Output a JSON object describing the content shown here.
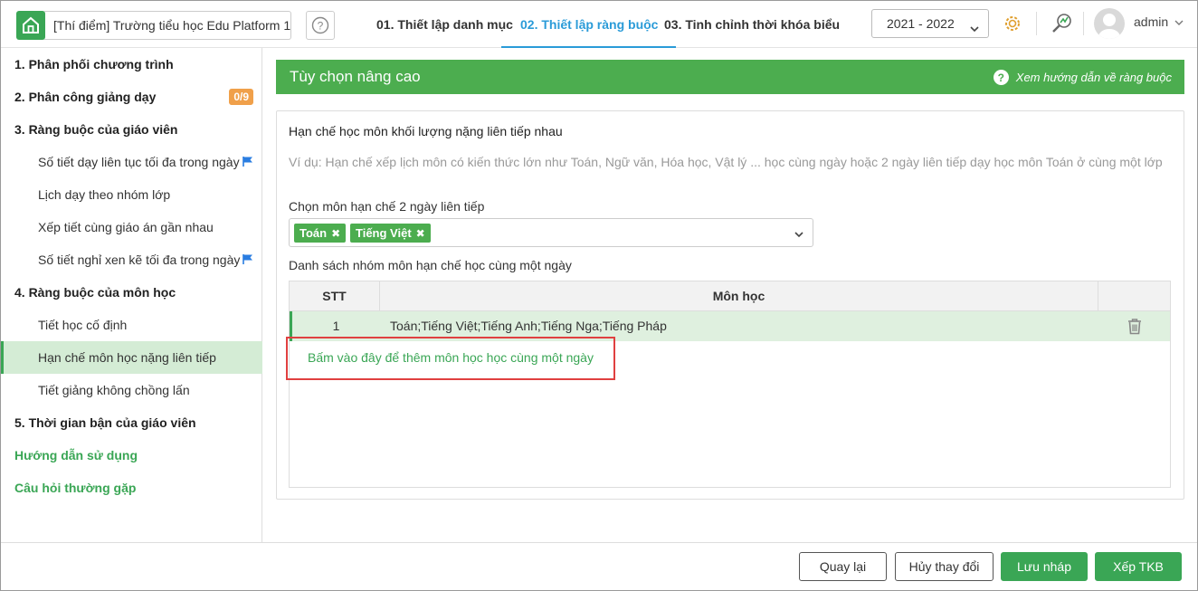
{
  "header": {
    "school_name": "[Thí điểm] Trường tiểu học Edu Platform 1",
    "tabs": [
      {
        "label": "01. Thiết lập danh mục",
        "active": false
      },
      {
        "label": "02. Thiết lập ràng buộc",
        "active": true
      },
      {
        "label": "03. Tinh chỉnh thời khóa biểu",
        "active": false
      }
    ],
    "school_year": "2021 - 2022",
    "user_name": "admin"
  },
  "sidebar": {
    "items": [
      {
        "label": "1. Phân phối chương trình",
        "level": "section"
      },
      {
        "label": "2. Phân công giảng dạy",
        "level": "section",
        "badge": "0/9"
      },
      {
        "label": "3. Ràng buộc của giáo viên",
        "level": "section"
      },
      {
        "label": "Số tiết dạy liên tục tối đa trong ngày",
        "level": "sub",
        "flag": true
      },
      {
        "label": "Lịch dạy theo nhóm lớp",
        "level": "sub"
      },
      {
        "label": "Xếp tiết cùng giáo án gần nhau",
        "level": "sub"
      },
      {
        "label": "Số tiết nghỉ xen kẽ tối đa trong ngày",
        "level": "sub",
        "flag": true
      },
      {
        "label": "4. Ràng buộc của môn học",
        "level": "section"
      },
      {
        "label": "Tiết học cố định",
        "level": "sub"
      },
      {
        "label": "Hạn chế môn học nặng liên tiếp",
        "level": "sub",
        "active": true
      },
      {
        "label": "Tiết giảng không chồng lấn",
        "level": "sub"
      },
      {
        "label": "5. Thời gian bận của giáo viên",
        "level": "section"
      },
      {
        "label": "Hướng dẫn sử dụng",
        "level": "link"
      },
      {
        "label": "Câu hỏi thường gặp",
        "level": "link"
      }
    ]
  },
  "main": {
    "title": "Tùy chọn nâng cao",
    "guide_link": "Xem hướng dẫn về ràng buộc",
    "heading": "Hạn chế học môn khối lượng nặng liên tiếp nhau",
    "example": "Ví dụ: Hạn chế xếp lịch môn có kiến thức lớn như Toán, Ngữ văn, Hóa học, Vật lý ... học cùng ngày hoặc 2 ngày liên tiếp dạy học môn Toán ở cùng một lớp",
    "select_label": "Chọn môn hạn chế 2 ngày liên tiếp",
    "selected_tags": [
      "Toán",
      "Tiếng Việt"
    ],
    "list_label": "Danh sách nhóm môn hạn chế học cùng một ngày",
    "table": {
      "columns": [
        "STT",
        "Môn học"
      ],
      "rows": [
        {
          "stt": "1",
          "subjects": "Toán;Tiếng Việt;Tiếng Anh;Tiếng Nga;Tiếng Pháp"
        }
      ],
      "add_link": "Bấm vào đây để thêm môn học học cùng một ngày"
    }
  },
  "footer": {
    "back": "Quay lại",
    "cancel": "Hủy thay đổi",
    "save_draft": "Lưu nháp",
    "schedule": "Xếp TKB"
  },
  "colors": {
    "brand_green": "#4cad4f",
    "active_tab_blue": "#2a9bd8",
    "badge_orange": "#f0a04a",
    "highlight_red": "#e04040"
  }
}
